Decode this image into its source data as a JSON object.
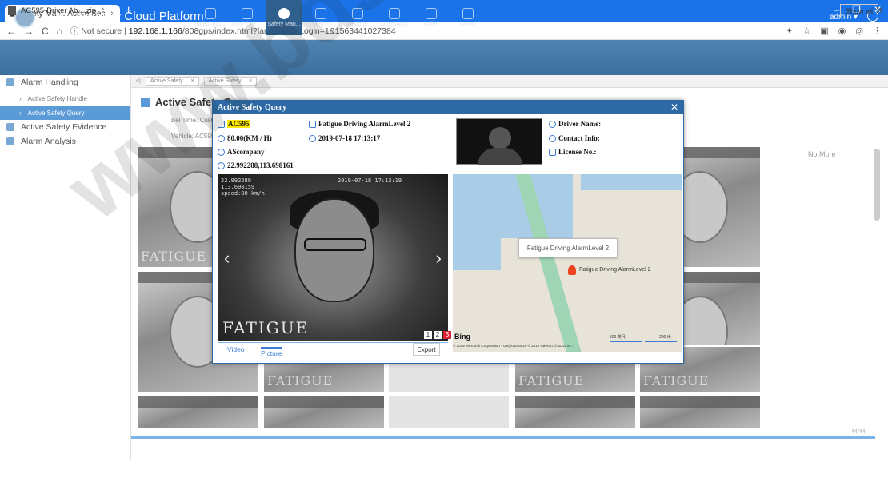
{
  "browser": {
    "tab_title": "Safety Man...Active Security C",
    "url_prefix": "Not secure",
    "url_host": "192.168.1.166",
    "url_path": "/808gps/index.html?lang=en&isLogin=1&1563441027384"
  },
  "app": {
    "title": "Active Security Cloud Platform",
    "nav": [
      {
        "label": "Safety Box..."
      },
      {
        "label": "Real-time ..."
      },
      {
        "label": "Safety Man..."
      },
      {
        "label": "Playback"
      },
      {
        "label": "Reports"
      },
      {
        "label": "Operations"
      },
      {
        "label": "Rules"
      },
      {
        "label": "Server"
      }
    ],
    "user": "admin"
  },
  "sidebar": {
    "items": [
      {
        "label": "Alarm Handling"
      },
      {
        "label": "Active Safety Handle"
      },
      {
        "label": "Active Safety Query"
      },
      {
        "label": "Active Safety Evidence"
      },
      {
        "label": "Alarm Analysis"
      }
    ]
  },
  "content": {
    "breadcrumbs": [
      "Active Safety ...",
      "Active Safety ..."
    ],
    "title": "Active Safety Query",
    "filter_time": "Bel Time: Custo",
    "filter_vehicle": "Vehicle: AC595",
    "no_more": "No More",
    "tile_caption": "FATIGUE",
    "page_num": "44/44"
  },
  "modal": {
    "title": "Active Safety Query",
    "vehicle": "AC595",
    "alarm": "Fatigue Driving AlarmLevel 2",
    "speed": "80.00(KM / H)",
    "time": "2019-07-18 17:13:17",
    "company": "AScompany",
    "coords": "22.992288,113.698161",
    "driver_name": "Driver Name:",
    "contact": "Contact Info:",
    "license": "License No.:",
    "photo_overlay": "22.992289\n113.698159\nspeed:80 km/h",
    "photo_time": "2019-07-18 17:13:19",
    "photo_caption": "FATIGUE",
    "pages": [
      "1",
      "2",
      "3"
    ],
    "tab_video": "Video",
    "tab_picture": "Picture",
    "export": "Export",
    "map_popup": "Fatigue Driving AlarmLevel 2",
    "map_marker_label": "Fatigue Driving AlarmLevel 2",
    "map_brand": "Bing",
    "map_copyright": "© 2019 Microsoft Corporation - GS(2018)5620 © 2019 Navinfo, © 2019 M...",
    "scale1": "500 英尺",
    "scale2": "200 米"
  },
  "download": {
    "file": "AC595-Driver Ab....zip",
    "show_all": "Show all"
  },
  "watermark": "www.bdsseka-s"
}
